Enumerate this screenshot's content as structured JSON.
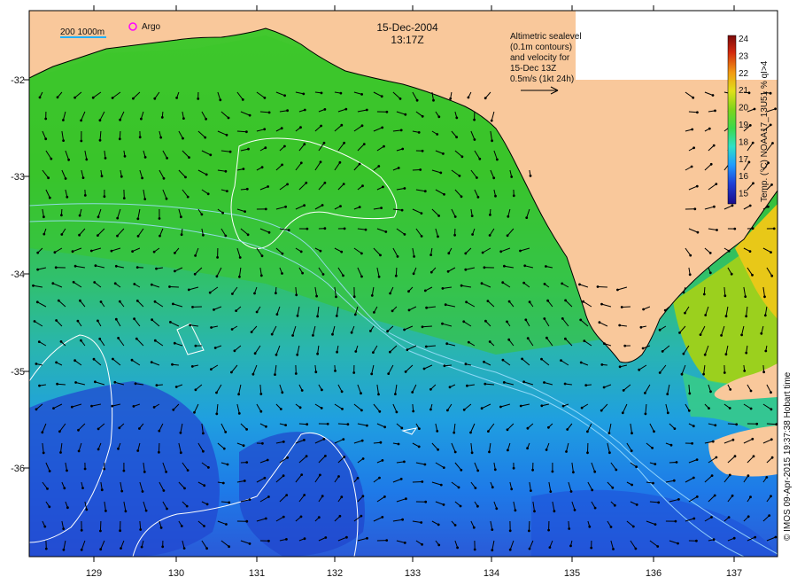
{
  "header": {
    "date": "15-Dec-2004",
    "time": "13:17Z"
  },
  "legend": {
    "scale_label": "200  1000m",
    "argo_label": "Argo"
  },
  "annotation": {
    "lines": [
      "Altimetric sealevel",
      "(0.1m contours)",
      "and velocity for",
      "15-Dec 13Z",
      "0.5m/s (1kt 24h)"
    ]
  },
  "colorbar": {
    "ticks": [
      "24",
      "23",
      "22",
      "21",
      "20",
      "19",
      "18",
      "17",
      "16",
      "15"
    ],
    "label": "Temp. (°C) NOAA17_13U51 % qI>4",
    "colors": [
      "#1a0c8a",
      "#1f3fd6",
      "#1f9bff",
      "#2fe0c8",
      "#3cd84a",
      "#7ed41c",
      "#e0e01a",
      "#f29a14",
      "#d2280e",
      "#7a0a0a"
    ]
  },
  "axes": {
    "x_ticks": [
      "129",
      "130",
      "131",
      "132",
      "133",
      "134",
      "135",
      "136",
      "137"
    ],
    "y_ticks": [
      "-32",
      "-33",
      "-34",
      "-35",
      "-36"
    ]
  },
  "credit": "© IMOS 09-Apr-2015 19:37:38 Hobart time",
  "colors": {
    "land": "#f9c89b",
    "ocean_warm": "#2fbf2a",
    "ocean_cool": "#1fa0e8",
    "ocean_cold": "#1a3fc8",
    "contour": "#ffffff",
    "bathy": "#a0e0ff",
    "argo": "#ff00ff"
  }
}
